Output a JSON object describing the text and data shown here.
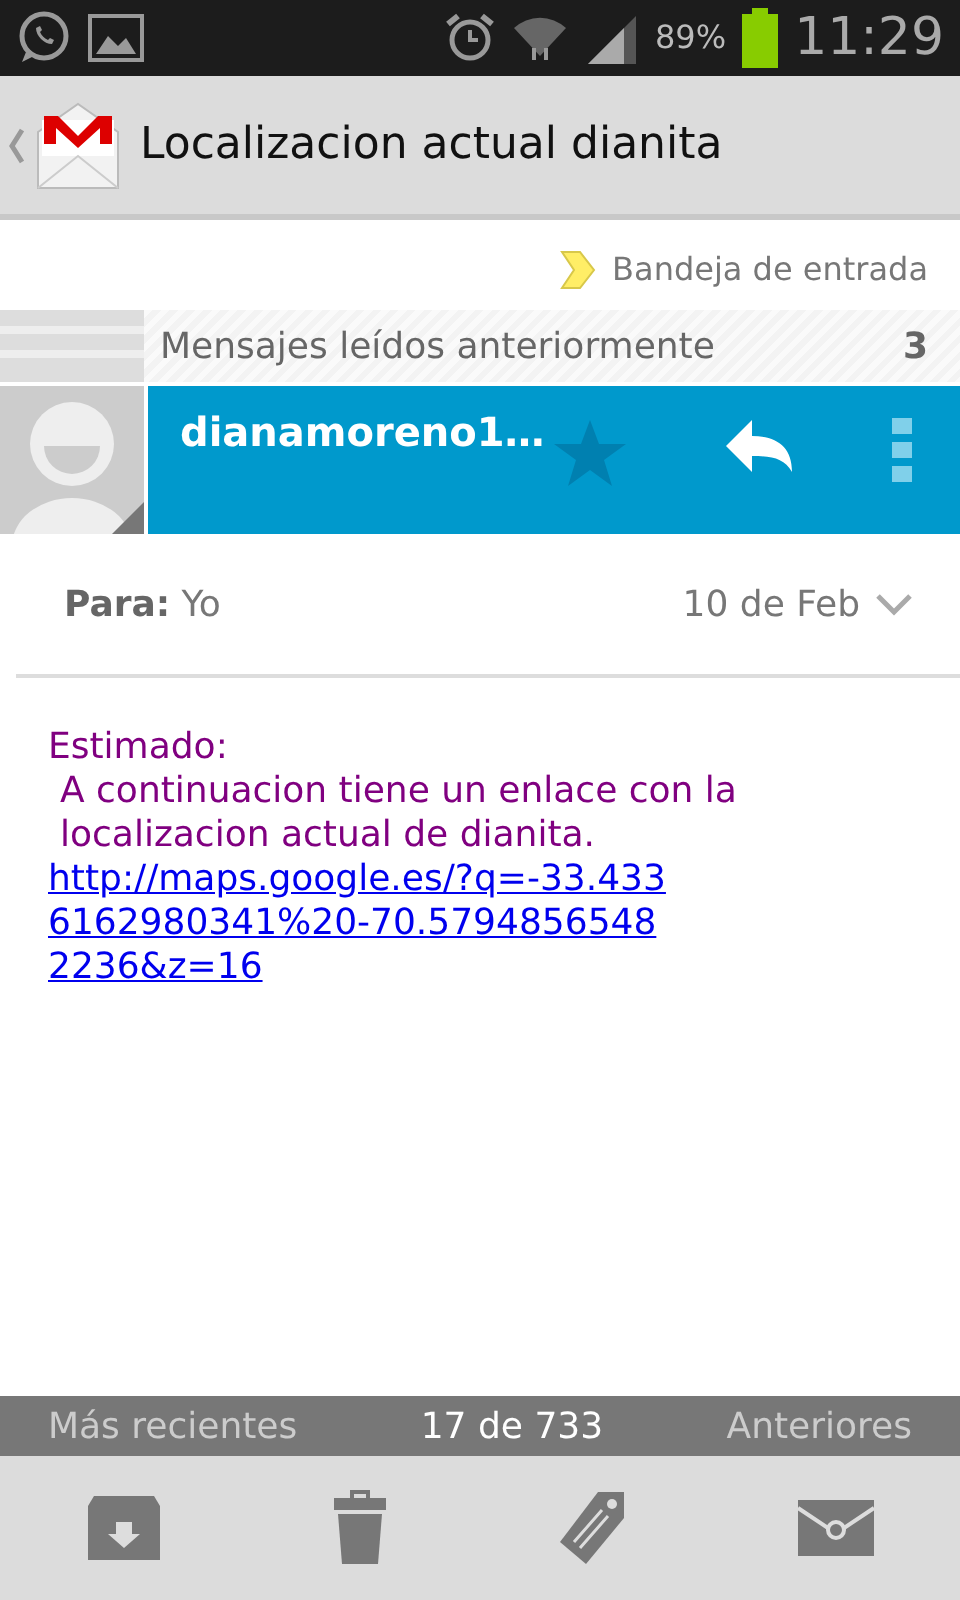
{
  "status_bar": {
    "battery": "89%",
    "time": "11:29"
  },
  "action_bar": {
    "title": "Localizacion actual dianita"
  },
  "label": "Bandeja de entrada",
  "collapsed": {
    "text": "Mensajes leídos anteriormente",
    "count": "3"
  },
  "sender": {
    "name": "dianamoreno1…",
    "starred": false
  },
  "recipient": {
    "label": "Para:",
    "value": "Yo"
  },
  "date": "10 de Feb",
  "body": {
    "lines": [
      "Estimado:",
      "A continuacion tiene un enlace con la localizacion actual de dianita."
    ],
    "link": "http://maps.google.es/?q=-33.4336162980341%20-70.57948565482236&z=16"
  },
  "pager": {
    "newer": "Más recientes",
    "position": "17 de 733",
    "older": "Anteriores"
  }
}
